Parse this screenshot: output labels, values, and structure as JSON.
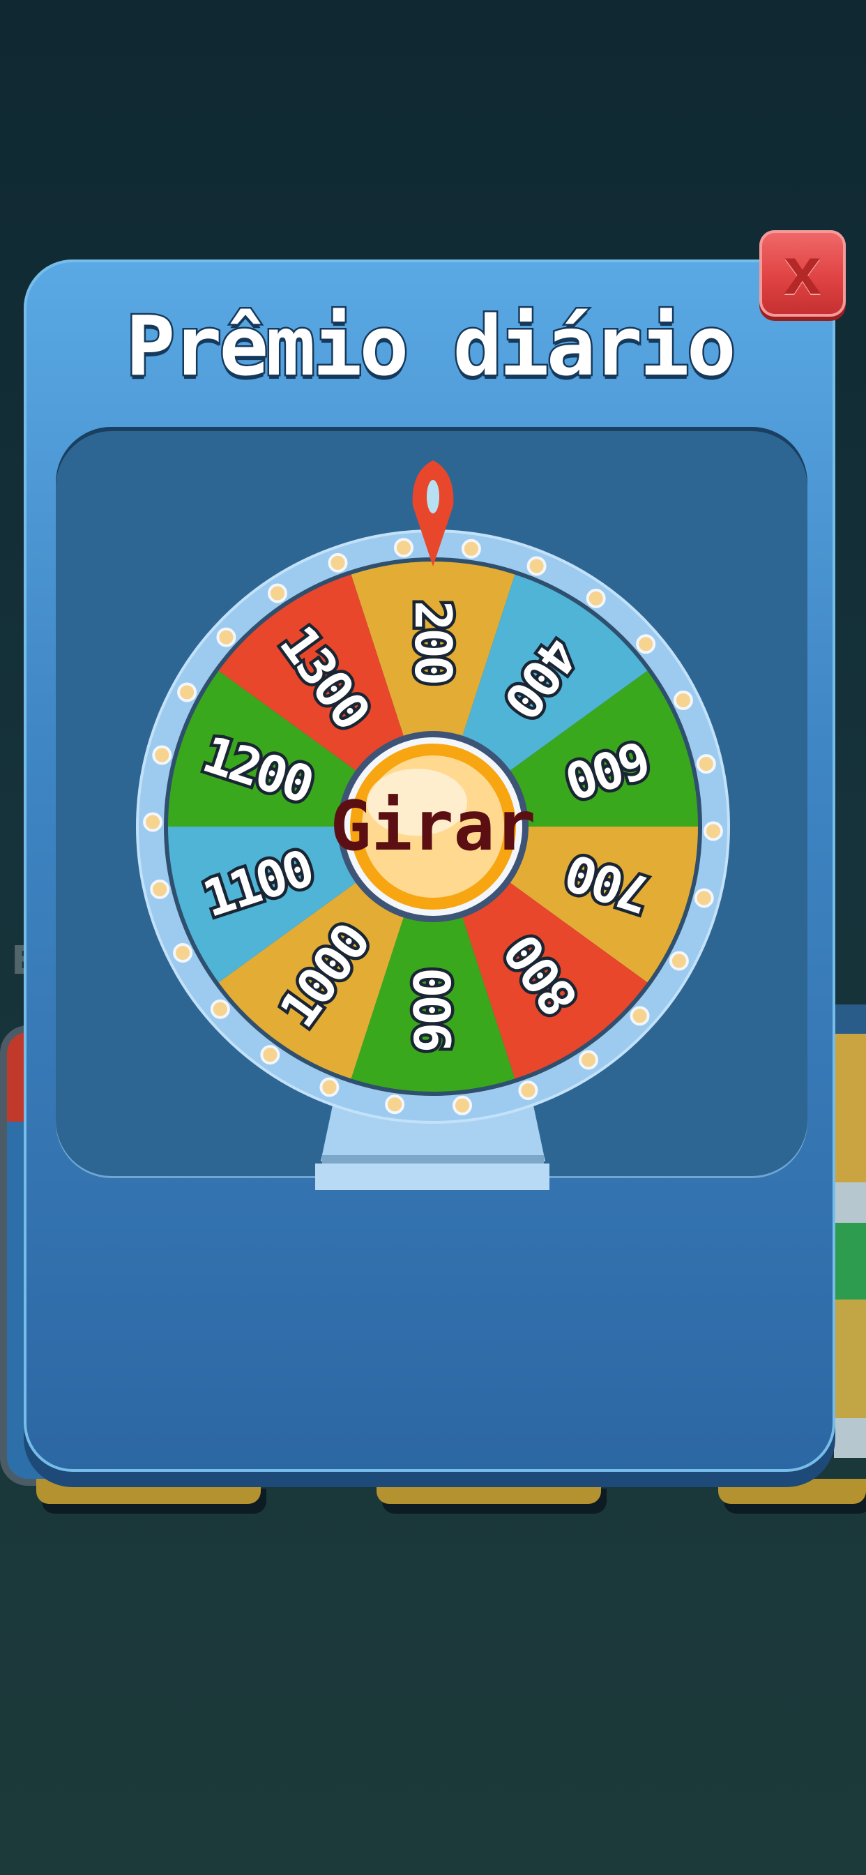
{
  "modal": {
    "title": "Prêmio diário",
    "close_label": "x"
  },
  "wheel": {
    "spin_label": "Girar",
    "segments": [
      {
        "label": "200",
        "color": "#e3ad35"
      },
      {
        "label": "400",
        "color": "#4fb4d6"
      },
      {
        "label": "600",
        "color": "#3aa81c"
      },
      {
        "label": "700",
        "color": "#e3ad35"
      },
      {
        "label": "800",
        "color": "#e8472c"
      },
      {
        "label": "900",
        "color": "#3aa81c"
      },
      {
        "label": "1000",
        "color": "#e3ad35"
      },
      {
        "label": "1100",
        "color": "#4fb4d6"
      },
      {
        "label": "1200",
        "color": "#3aa81c"
      },
      {
        "label": "1300",
        "color": "#e8472c"
      }
    ],
    "pointer_color": "#e8472c",
    "rim_color": "#9ccbef",
    "bulb_color": "#f6d38f"
  },
  "background": {
    "partial_letter": "E"
  }
}
